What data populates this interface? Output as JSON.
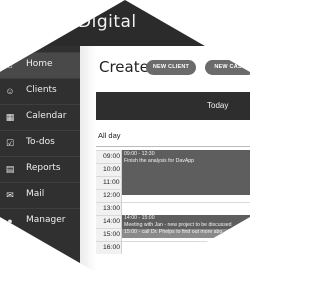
{
  "brand": {
    "title": "Digital"
  },
  "sidebar": {
    "items": [
      {
        "label": "Home",
        "icon": "home-icon",
        "active": true
      },
      {
        "label": "Clients",
        "icon": "users-icon"
      },
      {
        "label": "Calendar",
        "icon": "calendar-icon"
      },
      {
        "label": "To-dos",
        "icon": "checkbox-icon"
      },
      {
        "label": "Reports",
        "icon": "chart-icon"
      },
      {
        "label": "Mail",
        "icon": "mail-icon"
      },
      {
        "label": "Manager",
        "icon": "chat-icon"
      }
    ]
  },
  "main": {
    "title": "Create",
    "buttons": {
      "new_client": "NEW CLIENT",
      "new_case": "NEW CASE"
    },
    "calendar": {
      "header": "Today",
      "all_day": "All day",
      "times": [
        "09:00",
        "10:00",
        "11:00",
        "12:00",
        "13:00",
        "14:00",
        "15:00",
        "16:00"
      ],
      "events": [
        {
          "time": "09:00 - 12:30",
          "title": "Finish the analysis for DavApp"
        },
        {
          "time": "14:00 - 15:00",
          "title": "Meeting with Jan - new project to be discussed"
        },
        {
          "time": "15:00",
          "title": "15:00 - call Dr. Phelps to find out more abo"
        }
      ]
    }
  }
}
